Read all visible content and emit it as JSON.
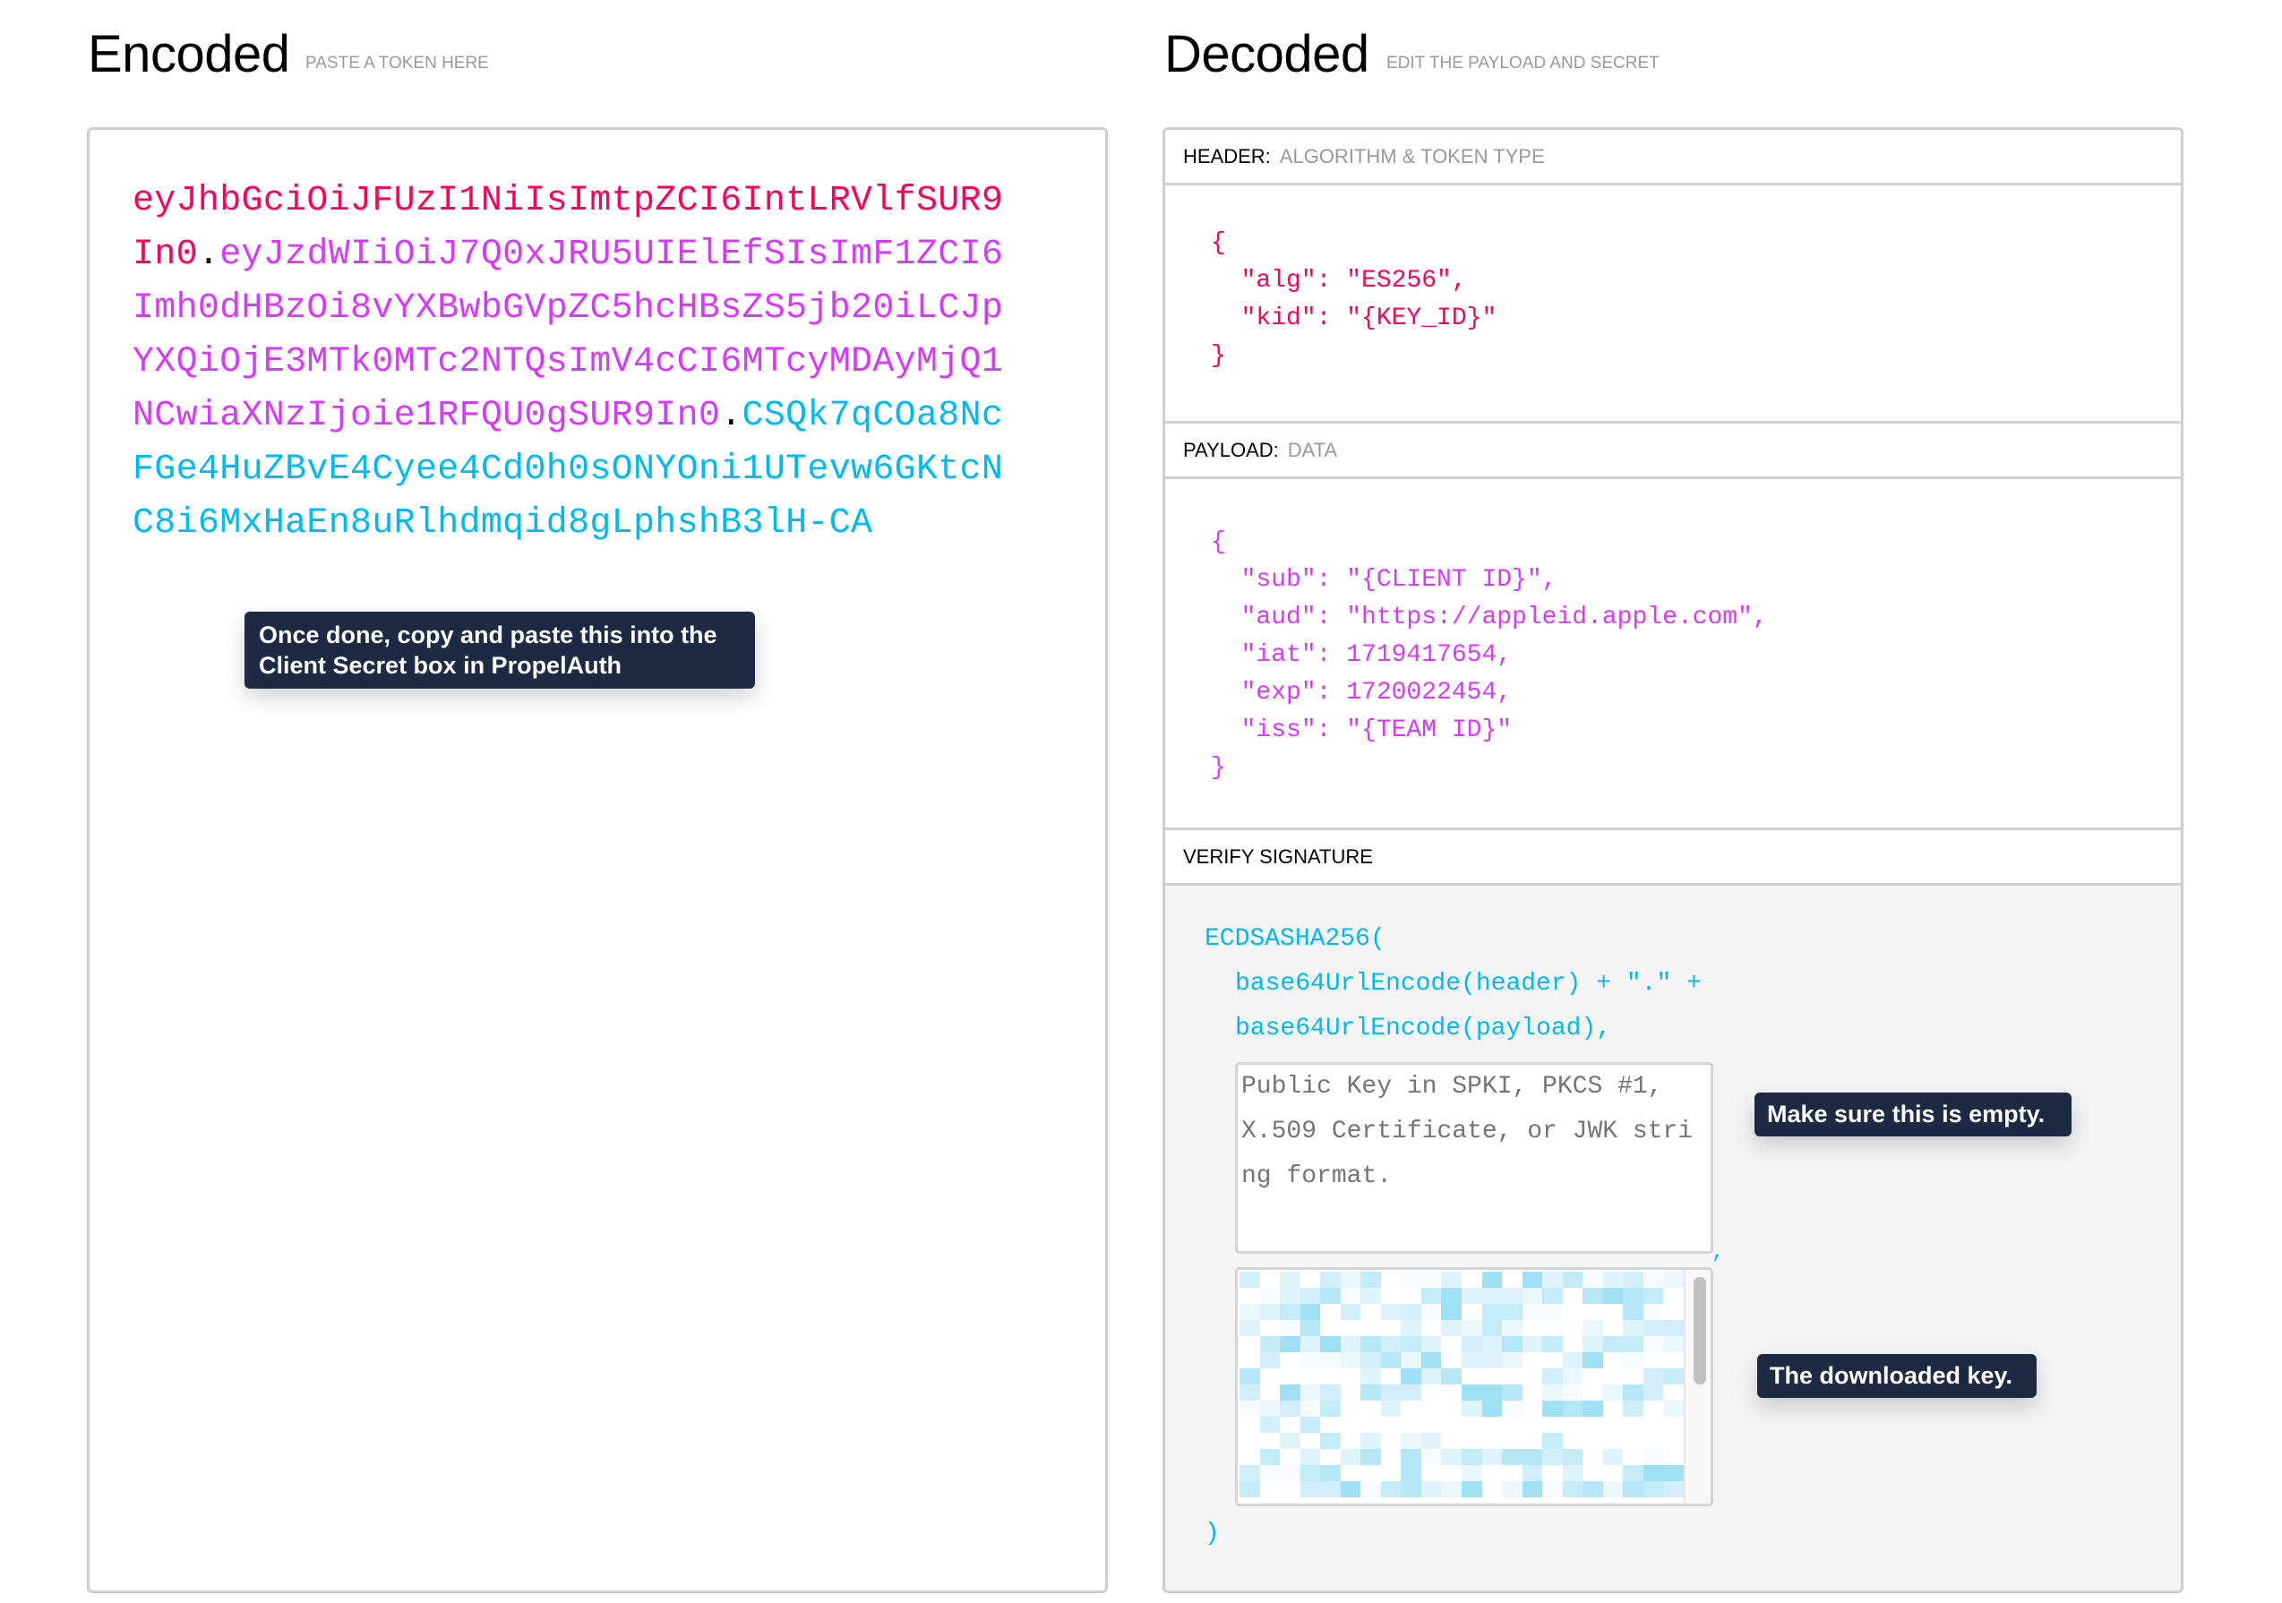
{
  "encoded": {
    "title": "Encoded",
    "subtitle": "PASTE A TOKEN HERE",
    "token": {
      "header": "eyJhbGciOiJFUzI1NiIsImtpZCI6IntLRVlfSUR9In0",
      "dot1": ".",
      "payload": "eyJzdWIiOiJ7Q0xJRU5UIElEfSIsImF1ZCI6Imh0dHBzOi8vYXBwbGVpZC5hcHBsZS5jb20iLCJpYXQiOjE3MTk0MTc2NTQsImV4cCI6MTcyMDAyMjQ1NCwiaXNzIjoie1RFQU0gSUR9In0",
      "dot2": ".",
      "signature": "CSQk7qCOa8NcFGe4HuZBvE4Cyee4Cd0h0sONYOni1UTevw6GKtcNC8i6MxHaEn8uRlhdmqid8gLphshB3lH-CA"
    },
    "tooltip": "Once done, copy and paste this into the Client Secret box in PropelAuth"
  },
  "decoded": {
    "title": "Decoded",
    "subtitle": "EDIT THE PAYLOAD AND SECRET",
    "header_section": {
      "label": "HEADER:",
      "sublabel": "ALGORITHM & TOKEN TYPE",
      "json_text": "{\n  \"alg\": \"ES256\",\n  \"kid\": \"{KEY_ID}\"\n}"
    },
    "payload_section": {
      "label": "PAYLOAD:",
      "sublabel": "DATA",
      "json_text": "{\n  \"sub\": \"{CLIENT ID}\",\n  \"aud\": \"https://appleid.apple.com\",\n  \"iat\": 1719417654,\n  \"exp\": 1720022454,\n  \"iss\": \"{TEAM ID}\"\n}"
    },
    "verify_section": {
      "label": "VERIFY SIGNATURE",
      "function_open": "ECDSASHA256(",
      "line2": "base64UrlEncode(header) + \".\" +",
      "line3": "base64UrlEncode(payload),",
      "comma": ",",
      "function_close": ")",
      "public_key_placeholder": "Public Key in SPKI, PKCS #1, X.509 Certificate, or JWK string format.",
      "public_key_value": "",
      "private_key_state": "redacted (blurred)",
      "tooltip_public": "Make sure this is empty.",
      "tooltip_private": "The downloaded key."
    }
  },
  "colors": {
    "header": "#fb015b",
    "payload": "#d63aff",
    "signature": "#00b9f1",
    "tooltip_bg": "#1d2a44",
    "verify_bg": "#f4f4f4"
  }
}
